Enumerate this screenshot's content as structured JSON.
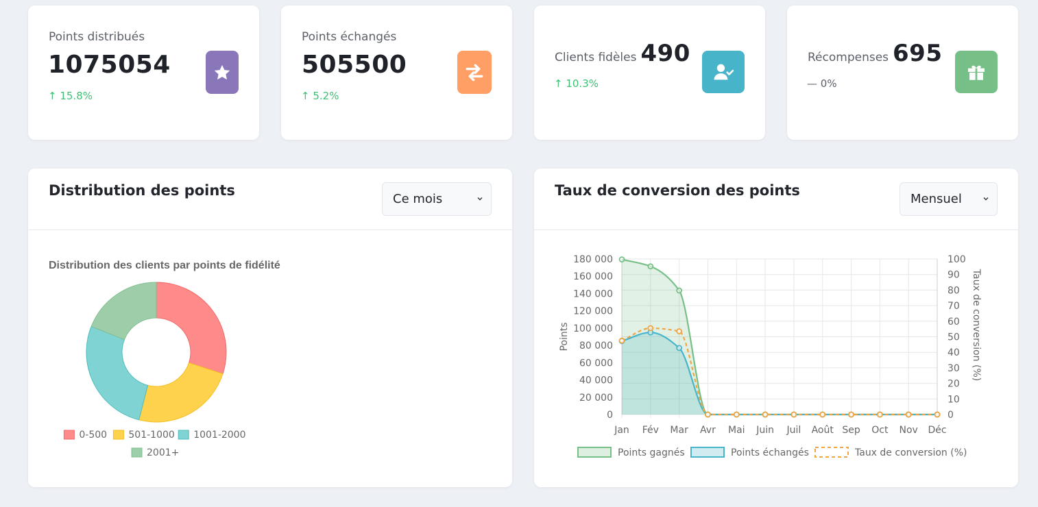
{
  "stats": [
    {
      "label": "Points distribués",
      "value": "1075054",
      "trend": "15.8%",
      "icon": "star-icon",
      "color": "#8a77b9"
    },
    {
      "label": "Points échangés",
      "value": "505500",
      "trend": "5.2%",
      "icon": "exchange-arrows-icon",
      "color": "#ff9f65"
    },
    {
      "label": "Clients fidèles",
      "value": "490",
      "trend": "10.3%",
      "icon": "user-check-icon",
      "color": "#48b4c9"
    },
    {
      "label": "Récompenses",
      "value": "695",
      "trend": "0%",
      "icon": "gift-icon",
      "color": "#76bf87"
    }
  ],
  "distribution_panel": {
    "title": "Distribution des points",
    "period_select": "Ce mois"
  },
  "conversion_panel": {
    "title": "Taux de conversion des points",
    "period_select": "Mensuel"
  },
  "chart_data": [
    {
      "type": "doughnut",
      "title": "Distribution des clients par points de fidélité",
      "categories": [
        "0-500",
        "501-1000",
        "1001-2000",
        "2001+"
      ],
      "values": [
        30,
        24,
        27,
        19
      ],
      "colors": [
        "#ff8a8a",
        "#ffd24d",
        "#80d3d3",
        "#9ecea9"
      ],
      "legend": "bottom"
    },
    {
      "type": "line",
      "x": [
        "Jan",
        "Fév",
        "Mar",
        "Avr",
        "Mai",
        "Juin",
        "Juil",
        "Août",
        "Sep",
        "Oct",
        "Nov",
        "Déc"
      ],
      "series": [
        {
          "name": "Points gagnés",
          "axis": "left",
          "color": "#76bf87",
          "values": [
            179500,
            171500,
            143500,
            0,
            0,
            0,
            0,
            0,
            0,
            0,
            0,
            0
          ]
        },
        {
          "name": "Points échangés",
          "axis": "left",
          "color": "#48b4c9",
          "values": [
            85000,
            95000,
            77000,
            0,
            0,
            0,
            0,
            0,
            0,
            0,
            0,
            0
          ]
        },
        {
          "name": "Taux de conversion (%)",
          "axis": "right",
          "color": "#f0a442",
          "values": [
            47.5,
            55.5,
            53.5,
            0,
            0,
            0,
            0,
            0,
            0,
            0,
            0,
            0
          ]
        }
      ],
      "y_left_label": "Points",
      "y_left_ticks": [
        "0",
        "20 000",
        "40 000",
        "60 000",
        "80 000",
        "100 000",
        "120 000",
        "140 000",
        "160 000",
        "180 000"
      ],
      "y_left_range": [
        0,
        180000
      ],
      "y_right_label": "Taux de conversion (%)",
      "y_right_ticks": [
        "0",
        "10",
        "20",
        "30",
        "40",
        "50",
        "60",
        "70",
        "80",
        "90",
        "100"
      ],
      "y_right_range": [
        0,
        100
      ],
      "grid": true,
      "legend": "bottom"
    }
  ]
}
